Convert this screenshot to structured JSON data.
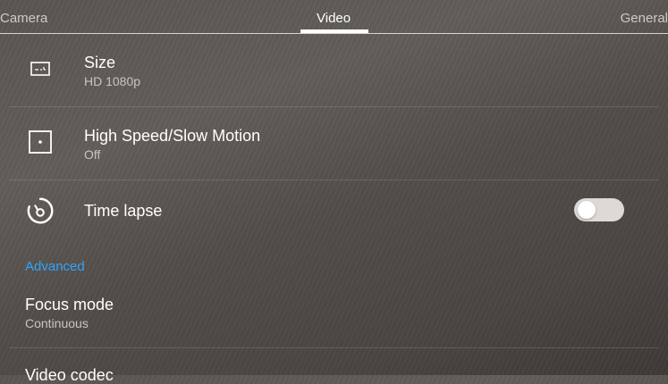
{
  "tabs": [
    {
      "label": "Camera",
      "active": false
    },
    {
      "label": "Video",
      "active": true
    },
    {
      "label": "General",
      "active": false
    }
  ],
  "settings": {
    "size": {
      "title": "Size",
      "value": "HD 1080p",
      "icon": "video-size-icon"
    },
    "high_speed": {
      "title": "High Speed/Slow Motion",
      "value": "Off",
      "icon": "slow-motion-icon"
    },
    "time_lapse": {
      "title": "Time lapse",
      "enabled": false,
      "icon": "time-lapse-icon"
    }
  },
  "advanced": {
    "header": "Advanced",
    "focus_mode": {
      "title": "Focus mode",
      "value": "Continuous"
    },
    "video_codec": {
      "title": "Video codec"
    }
  },
  "colors": {
    "accent": "#2ea5ff"
  }
}
